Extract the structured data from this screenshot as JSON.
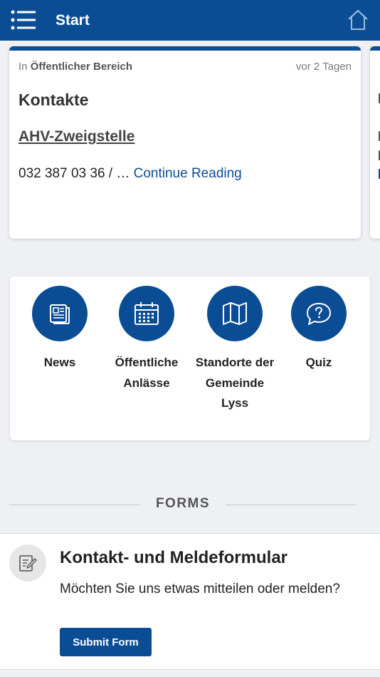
{
  "header": {
    "title": "Start",
    "menu_icon": "list-menu-icon",
    "home_icon": "home-icon",
    "bg_color": "#0b4d95"
  },
  "card": {
    "meta_prefix": "In",
    "category": "Öffentlicher Bereich",
    "time": "vor 2 Tagen",
    "title": "Kontakte",
    "link": "AHV-Zweigstelle",
    "excerpt": "032 387 03 36 /  …",
    "more": "Continue Reading"
  },
  "quick_links": [
    {
      "label": "News",
      "icon": "newspaper-icon"
    },
    {
      "label": "Öffentliche Anlässe",
      "icon": "calendar-icon"
    },
    {
      "label": "Standorte der Gemeinde Lyss",
      "icon": "map-icon"
    },
    {
      "label": "Quiz",
      "icon": "question-bubble-icon"
    }
  ],
  "forms": {
    "section_label": "FORMS",
    "title": "Kontakt- und Meldeformular",
    "description": "Möchten Sie uns etwas mitteilen oder melden?",
    "submit_label": "Submit Form",
    "icon": "edit-form-icon"
  }
}
